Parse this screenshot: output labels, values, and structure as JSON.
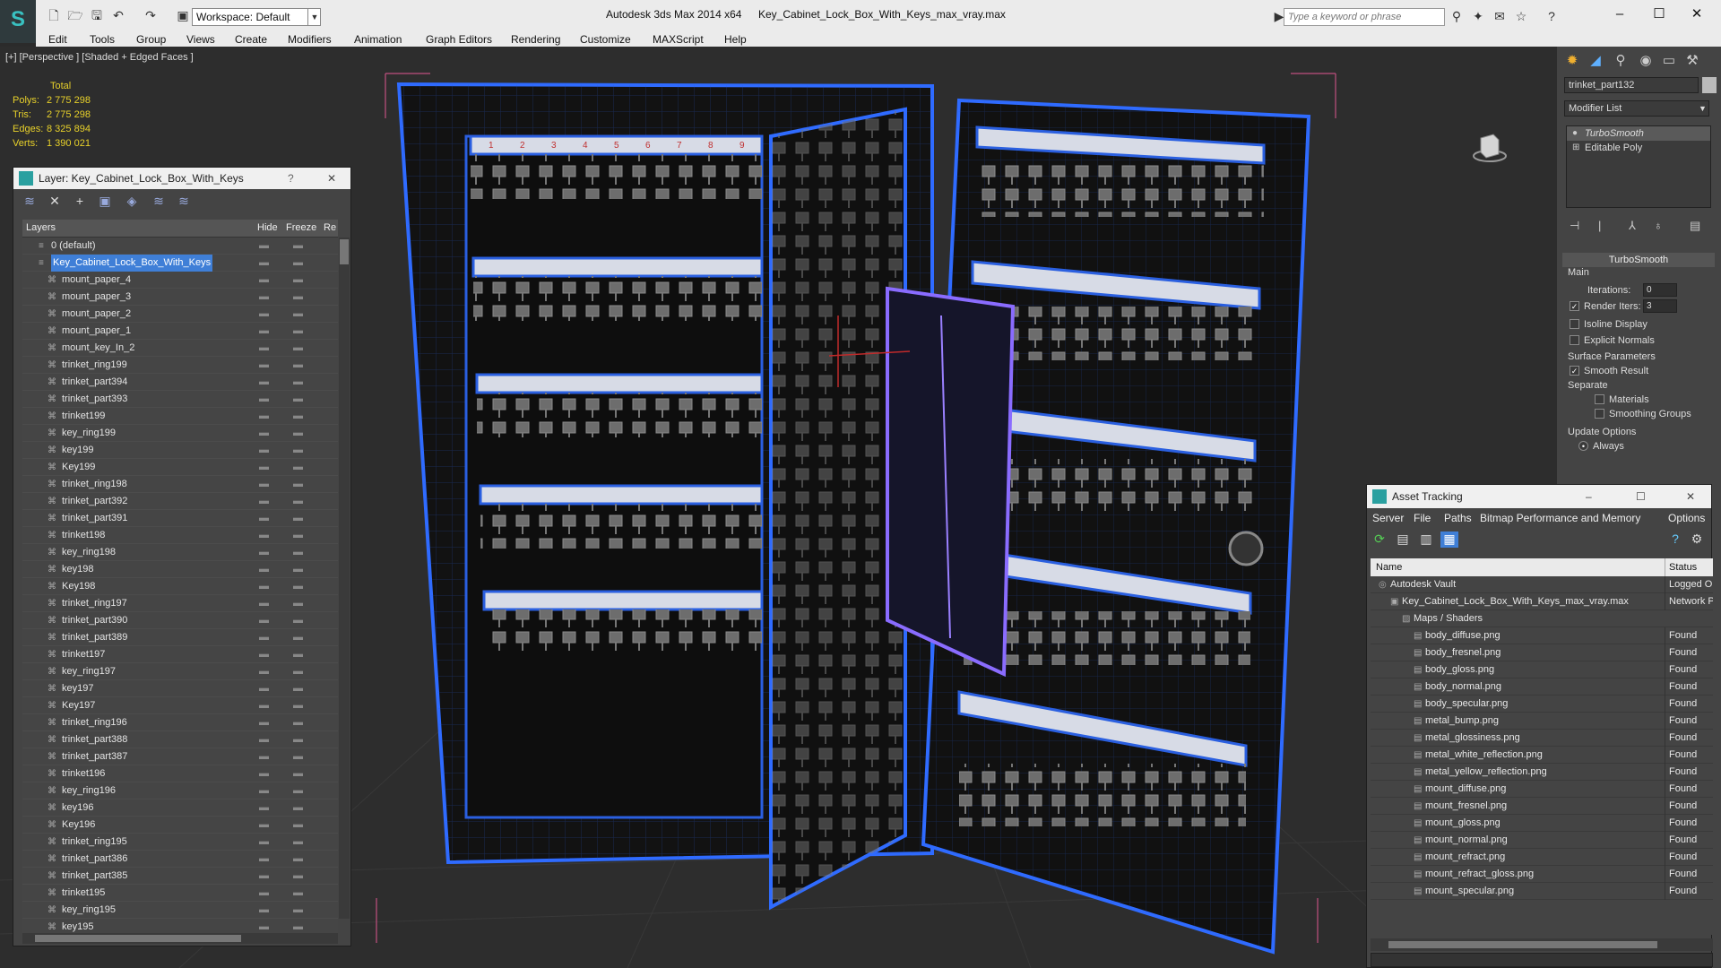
{
  "titlebar": {
    "workspace": "Workspace: Default",
    "app_title": "Autodesk 3ds Max  2014 x64",
    "file_title": "Key_Cabinet_Lock_Box_With_Keys_max_vray.max",
    "search_placeholder": "Type a keyword or phrase"
  },
  "menu": [
    "Edit",
    "Tools",
    "Group",
    "Views",
    "Create",
    "Modifiers",
    "Animation",
    "Graph Editors",
    "Rendering",
    "Customize",
    "MAXScript",
    "Help"
  ],
  "viewport": {
    "label": "[+] [Perspective ] [Shaded + Edged Faces ]",
    "stats": {
      "header": "Total",
      "polys_label": "Polys:",
      "polys": "2 775 298",
      "tris_label": "Tris:",
      "tris": "2 775 298",
      "edges_label": "Edges:",
      "edges": "8 325 894",
      "verts_label": "Verts:",
      "verts": "1 390 021"
    }
  },
  "layer_window": {
    "title": "Layer: Key_Cabinet_Lock_Box_With_Keys",
    "col_layers": "Layers",
    "col_hide": "Hide",
    "col_freeze": "Freeze",
    "col_render": "Re",
    "rows": [
      {
        "name": "0 (default)",
        "top": true
      },
      {
        "name": "Key_Cabinet_Lock_Box_With_Keys",
        "top": true,
        "selected": true
      },
      {
        "name": "mount_paper_4"
      },
      {
        "name": "mount_paper_3"
      },
      {
        "name": "mount_paper_2"
      },
      {
        "name": "mount_paper_1"
      },
      {
        "name": "mount_key_In_2"
      },
      {
        "name": "trinket_ring199"
      },
      {
        "name": "trinket_part394"
      },
      {
        "name": "trinket_part393"
      },
      {
        "name": "trinket199"
      },
      {
        "name": "key_ring199"
      },
      {
        "name": "key199"
      },
      {
        "name": "Key199"
      },
      {
        "name": "trinket_ring198"
      },
      {
        "name": "trinket_part392"
      },
      {
        "name": "trinket_part391"
      },
      {
        "name": "trinket198"
      },
      {
        "name": "key_ring198"
      },
      {
        "name": "key198"
      },
      {
        "name": "Key198"
      },
      {
        "name": "trinket_ring197"
      },
      {
        "name": "trinket_part390"
      },
      {
        "name": "trinket_part389"
      },
      {
        "name": "trinket197"
      },
      {
        "name": "key_ring197"
      },
      {
        "name": "key197"
      },
      {
        "name": "Key197"
      },
      {
        "name": "trinket_ring196"
      },
      {
        "name": "trinket_part388"
      },
      {
        "name": "trinket_part387"
      },
      {
        "name": "trinket196"
      },
      {
        "name": "key_ring196"
      },
      {
        "name": "key196"
      },
      {
        "name": "Key196"
      },
      {
        "name": "trinket_ring195"
      },
      {
        "name": "trinket_part386"
      },
      {
        "name": "trinket_part385"
      },
      {
        "name": "trinket195"
      },
      {
        "name": "key_ring195"
      },
      {
        "name": "key195"
      }
    ]
  },
  "command_panel": {
    "object_name": "trinket_part132",
    "modifier_list": "Modifier List",
    "stack": [
      "TurboSmooth",
      "Editable Poly"
    ],
    "rollout": "TurboSmooth",
    "main": "Main",
    "iterations_label": "Iterations:",
    "iterations": "0",
    "render_iters_label": "Render Iters:",
    "render_iters": "3",
    "isoline": "Isoline Display",
    "explicit_normals": "Explicit Normals",
    "surface_params": "Surface Parameters",
    "smooth_result": "Smooth Result",
    "separate": "Separate",
    "materials": "Materials",
    "smoothing_groups": "Smoothing Groups",
    "update_options": "Update Options",
    "always": "Always"
  },
  "asset_window": {
    "title": "Asset Tracking",
    "menu": [
      "Server",
      "File",
      "Paths",
      "Bitmap Performance and Memory",
      "Options"
    ],
    "col_name": "Name",
    "col_status": "Status",
    "rows": [
      {
        "name": "Autodesk Vault",
        "status": "Logged O",
        "level": 0
      },
      {
        "name": "Key_Cabinet_Lock_Box_With_Keys_max_vray.max",
        "status": "Network P",
        "level": 1
      },
      {
        "name": "Maps / Shaders",
        "status": "",
        "level": 2
      },
      {
        "name": "body_diffuse.png",
        "status": "Found",
        "level": 3
      },
      {
        "name": "body_fresnel.png",
        "status": "Found",
        "level": 3
      },
      {
        "name": "body_gloss.png",
        "status": "Found",
        "level": 3
      },
      {
        "name": "body_normal.png",
        "status": "Found",
        "level": 3
      },
      {
        "name": "body_specular.png",
        "status": "Found",
        "level": 3
      },
      {
        "name": "metal_bump.png",
        "status": "Found",
        "level": 3
      },
      {
        "name": "metal_glossiness.png",
        "status": "Found",
        "level": 3
      },
      {
        "name": "metal_white_reflection.png",
        "status": "Found",
        "level": 3
      },
      {
        "name": "metal_yellow_reflection.png",
        "status": "Found",
        "level": 3
      },
      {
        "name": "mount_diffuse.png",
        "status": "Found",
        "level": 3
      },
      {
        "name": "mount_fresnel.png",
        "status": "Found",
        "level": 3
      },
      {
        "name": "mount_gloss.png",
        "status": "Found",
        "level": 3
      },
      {
        "name": "mount_normal.png",
        "status": "Found",
        "level": 3
      },
      {
        "name": "mount_refract.png",
        "status": "Found",
        "level": 3
      },
      {
        "name": "mount_refract_gloss.png",
        "status": "Found",
        "level": 3
      },
      {
        "name": "mount_specular.png",
        "status": "Found",
        "level": 3
      }
    ]
  },
  "shelf_numbers": [
    "1",
    "2",
    "3",
    "4",
    "5",
    "6",
    "7",
    "8",
    "9"
  ]
}
